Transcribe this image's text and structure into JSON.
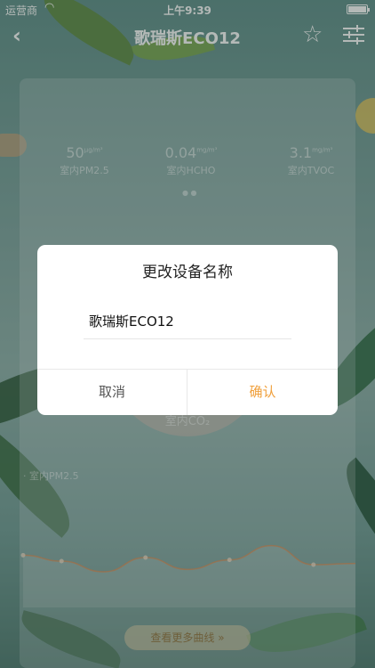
{
  "status_bar": {
    "carrier": "运营商",
    "time": "上午9:39"
  },
  "nav": {
    "title": "歌瑞斯ECO12"
  },
  "metrics": [
    {
      "value": "50",
      "unit": "μg/m³",
      "label": "室内PM2.5"
    },
    {
      "value": "0.04",
      "unit": "mg/m³",
      "label": "室内HCHO"
    },
    {
      "value": "3.1",
      "unit": "mg/m³",
      "label": "室内TVOC"
    }
  ],
  "gauge_label": "室内CO₂",
  "chart": {
    "title": "· 室内PM2.5",
    "more_label": "查看更多曲线 »"
  },
  "chart_data": {
    "type": "line",
    "series": [
      {
        "values": [
          5,
          4.5,
          3.6,
          4.8,
          3.8,
          4.6,
          5.8,
          4.2,
          4.3
        ]
      }
    ]
  },
  "dialog": {
    "title": "更改设备名称",
    "input_value": "歌瑞斯ECO12",
    "cancel_label": "取消",
    "confirm_label": "确认"
  },
  "colors": {
    "accent": "#f0a03c"
  }
}
